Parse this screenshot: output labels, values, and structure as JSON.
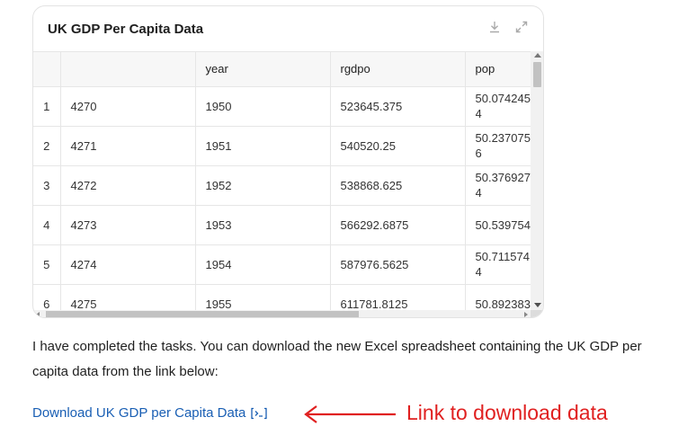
{
  "card": {
    "title": "UK GDP Per Capita Data",
    "icons": [
      "download-icon",
      "expand-icon"
    ]
  },
  "table": {
    "columns": [
      "",
      "",
      "year",
      "rgdpo",
      "pop"
    ],
    "rows": [
      {
        "index": "1",
        "id": "4270",
        "year": "1950",
        "rgdpo": "523645.375",
        "pop": "50.0742454"
      },
      {
        "index": "2",
        "id": "4271",
        "year": "1951",
        "rgdpo": "540520.25",
        "pop": "50.2370756"
      },
      {
        "index": "3",
        "id": "4272",
        "year": "1952",
        "rgdpo": "538868.625",
        "pop": "50.3769274"
      },
      {
        "index": "4",
        "id": "4273",
        "year": "1953",
        "rgdpo": "566292.6875",
        "pop": "50.539754"
      },
      {
        "index": "5",
        "id": "4274",
        "year": "1954",
        "rgdpo": "587976.5625",
        "pop": "50.7115744"
      },
      {
        "index": "6",
        "id": "4275",
        "year": "1955",
        "rgdpo": "611781.8125",
        "pop": "50.892383"
      }
    ]
  },
  "message": "I have completed the tasks. You can download the new Excel spreadsheet containing the UK GDP per capita data from the link below:",
  "link": {
    "label": "Download UK GDP per Capita Data",
    "icon": "code-link-icon"
  },
  "annotation": {
    "text": "Link to download data",
    "color": "#e02020"
  },
  "colors": {
    "link": "#1a5fb4",
    "annotation": "#e02020"
  }
}
